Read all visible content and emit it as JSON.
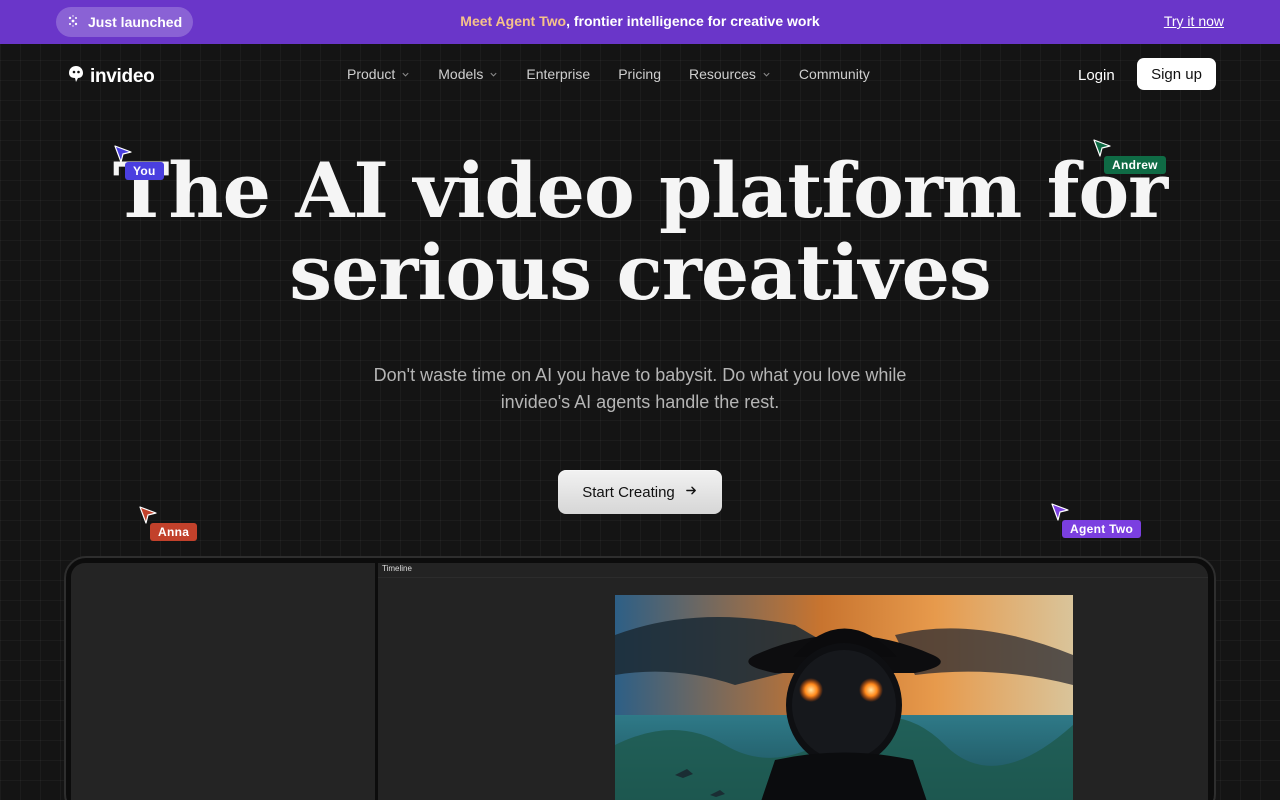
{
  "announcement": {
    "badge": "Just launched",
    "highlight": "Meet Agent Two",
    "message": ", frontier intelligence for creative work",
    "cta": "Try it now"
  },
  "nav": {
    "logo": "invideo",
    "items": [
      {
        "label": "Product",
        "dropdown": true
      },
      {
        "label": "Models",
        "dropdown": true
      },
      {
        "label": "Enterprise",
        "dropdown": false
      },
      {
        "label": "Pricing",
        "dropdown": false
      },
      {
        "label": "Resources",
        "dropdown": true
      },
      {
        "label": "Community",
        "dropdown": false
      }
    ],
    "login": "Login",
    "signup": "Sign up"
  },
  "hero": {
    "title_line1": "The AI video platform for",
    "title_line2": "serious creatives",
    "subtitle": "Don't waste time on AI you have to babysit. Do what you love while invideo's AI agents handle the rest.",
    "cta": "Start Creating"
  },
  "cursors": [
    {
      "name": "You",
      "color": "#4a3fe0"
    },
    {
      "name": "Andrew",
      "color": "#0f6b45"
    },
    {
      "name": "Anna",
      "color": "#c2412b"
    },
    {
      "name": "Agent Two",
      "color": "#7b3fe0"
    }
  ],
  "editor": {
    "timeline_label": "Timeline"
  },
  "colors": {
    "announcement_bg": "#6a36c9",
    "highlight": "#f6c28a",
    "page_bg": "#141414"
  }
}
